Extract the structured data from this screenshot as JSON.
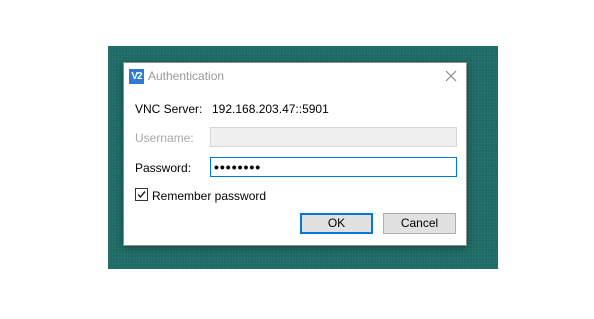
{
  "window": {
    "title": "Authentication",
    "icon": "vnc-viewer-logo",
    "icon_text": "V2",
    "close_icon": "close-icon"
  },
  "server": {
    "label": "VNC Server:",
    "value": "192.168.203.47::5901"
  },
  "username": {
    "label": "Username:",
    "value": "",
    "enabled": false
  },
  "password": {
    "label": "Password:",
    "value": "••••••••"
  },
  "remember": {
    "label": "Remember password",
    "checked": true
  },
  "buttons": {
    "ok_label": "OK",
    "cancel_label": "Cancel"
  },
  "colors": {
    "backdrop": "#1f6b66",
    "accent": "#0078d7",
    "icon_bg": "#2f7bd0"
  }
}
